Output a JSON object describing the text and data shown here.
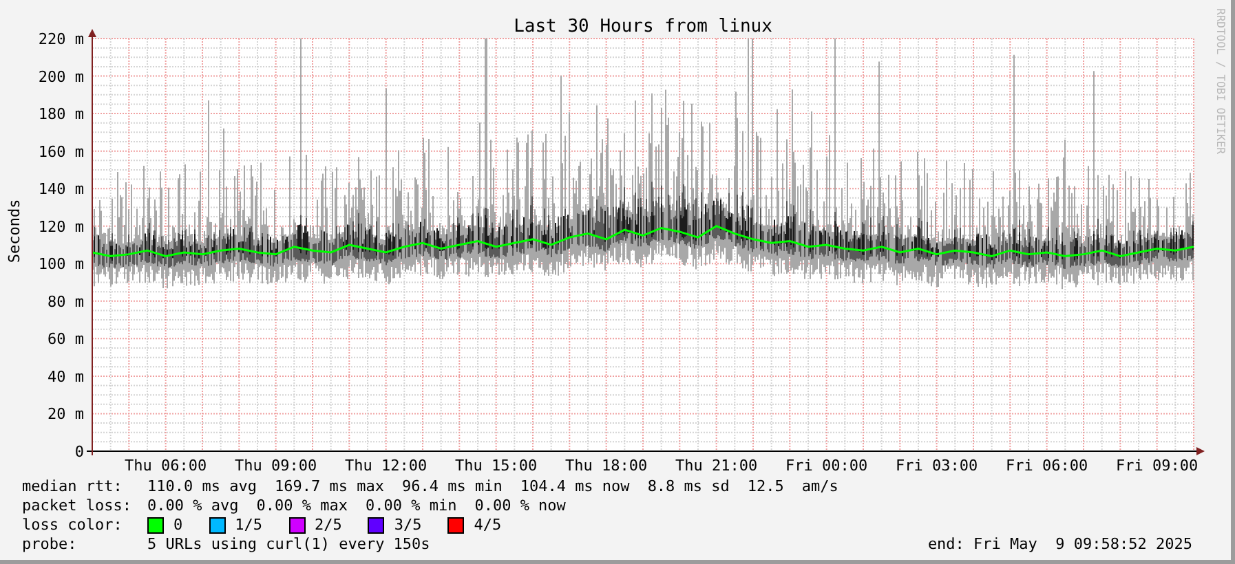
{
  "graph": {
    "credit": "RRDTOOL / TOBI OETIKER",
    "chart_data": {
      "type": "line",
      "title": "Last 30 Hours from linux",
      "ylabel": "Seconds",
      "ylim": [
        0,
        220
      ],
      "grid": true,
      "yticks": [
        {
          "value": 0,
          "label": "0"
        },
        {
          "value": 20,
          "label": "20 m"
        },
        {
          "value": 40,
          "label": "40 m"
        },
        {
          "value": 60,
          "label": "60 m"
        },
        {
          "value": 80,
          "label": "80 m"
        },
        {
          "value": 100,
          "label": "100 m"
        },
        {
          "value": 120,
          "label": "120 m"
        },
        {
          "value": 140,
          "label": "140 m"
        },
        {
          "value": 160,
          "label": "160 m"
        },
        {
          "value": 180,
          "label": "180 m"
        },
        {
          "value": 200,
          "label": "200 m"
        },
        {
          "value": 220,
          "label": "220 m"
        }
      ],
      "categories": [
        null,
        null,
        null,
        null,
        "Thu 06:00",
        null,
        null,
        null,
        null,
        null,
        "Thu 09:00",
        null,
        null,
        null,
        null,
        null,
        "Thu 12:00",
        null,
        null,
        null,
        null,
        null,
        "Thu 15:00",
        null,
        null,
        null,
        null,
        null,
        "Thu 18:00",
        null,
        null,
        null,
        null,
        null,
        "Thu 21:00",
        null,
        null,
        null,
        null,
        null,
        "Fri 00:00",
        null,
        null,
        null,
        null,
        null,
        "Fri 03:00",
        null,
        null,
        null,
        null,
        null,
        "Fri 06:00",
        null,
        null,
        null,
        null,
        null,
        "Fri 09:00",
        null,
        null
      ],
      "series": [
        {
          "color": "#00ff00",
          "values": [
            106,
            104,
            105,
            107,
            104,
            106,
            105,
            107,
            108,
            106,
            105,
            109,
            107,
            106,
            110,
            108,
            106,
            109,
            111,
            108,
            110,
            112,
            109,
            111,
            113,
            110,
            114,
            116,
            113,
            118,
            115,
            119,
            117,
            114,
            120,
            116,
            113,
            111,
            112,
            109,
            110,
            108,
            107,
            109,
            106,
            108,
            105,
            107,
            106,
            104,
            107,
            105,
            106,
            104,
            105,
            107,
            104,
            106,
            108,
            107,
            109
          ]
        }
      ]
    }
  },
  "legend": {
    "median_rtt": {
      "label": "median rtt:",
      "values": [
        "110.0 ms avg",
        "169.7 ms max",
        "96.4 ms min",
        "104.4 ms now",
        "8.8 ms sd",
        "12.5",
        "am/s"
      ]
    },
    "packet_loss": {
      "label": "packet loss:",
      "values": [
        "0.00 % avg",
        "0.00 % max",
        "0.00 % min",
        "0.00 % now"
      ]
    },
    "loss_color": {
      "label": "loss color:",
      "items": [
        {
          "label": "0",
          "color": "#00ff00"
        },
        {
          "label": "1/5",
          "color": "#00b8ff"
        },
        {
          "label": "2/5",
          "color": "#d000ff"
        },
        {
          "label": "3/5",
          "color": "#6000ff"
        },
        {
          "label": "4/5",
          "color": "#ff0000"
        }
      ]
    },
    "probe": {
      "label": "probe:",
      "text": "5 URLs using curl(1) every 150s"
    },
    "end": "end: Fri May  9 09:58:52 2025"
  }
}
